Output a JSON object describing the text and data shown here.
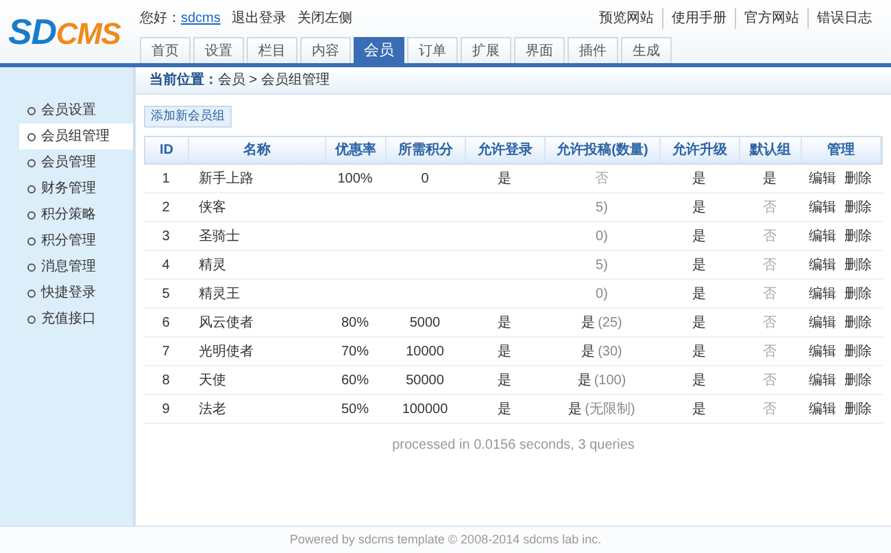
{
  "logo": {
    "left": "SD",
    "right": "CMS"
  },
  "user_bar": {
    "greeting": "您好：",
    "username": "sdcms",
    "links": [
      "退出登录",
      "关闭左侧"
    ]
  },
  "top_links": [
    "预览网站",
    "使用手册",
    "官方网站",
    "错误日志"
  ],
  "tabs": [
    {
      "label": "首页",
      "selected": false
    },
    {
      "label": "设置",
      "selected": false
    },
    {
      "label": "栏目",
      "selected": false
    },
    {
      "label": "内容",
      "selected": false
    },
    {
      "label": "会员",
      "selected": true
    },
    {
      "label": "订单",
      "selected": false
    },
    {
      "label": "扩展",
      "selected": false
    },
    {
      "label": "界面",
      "selected": false
    },
    {
      "label": "插件",
      "selected": false
    },
    {
      "label": "生成",
      "selected": false
    }
  ],
  "sidebar": {
    "items": [
      {
        "label": "会员设置",
        "selected": false
      },
      {
        "label": "会员组管理",
        "selected": true
      },
      {
        "label": "会员管理",
        "selected": false
      },
      {
        "label": "财务管理",
        "selected": false
      },
      {
        "label": "积分策略",
        "selected": false
      },
      {
        "label": "积分管理",
        "selected": false
      },
      {
        "label": "消息管理",
        "selected": false
      },
      {
        "label": "快捷登录",
        "selected": false
      },
      {
        "label": "充值接口",
        "selected": false
      }
    ]
  },
  "breadcrumb": {
    "label": "当前位置：",
    "path": "会员 > 会员组管理"
  },
  "add_button": "添加新会员组",
  "table": {
    "columns": [
      "ID",
      "名称",
      "优惠率",
      "所需积分",
      "允许登录",
      "允许投稿(数量)",
      "允许升级",
      "默认组",
      "管理"
    ],
    "rows": [
      {
        "id": "1",
        "name": "新手上路",
        "discount": "100%",
        "points": "0",
        "login": {
          "text": "是",
          "dim": false
        },
        "submit": {
          "text": "否",
          "dim": true
        },
        "upgrade": {
          "text": "是",
          "dim": false
        },
        "default": {
          "text": "是",
          "dim": false
        },
        "actions": [
          "编辑",
          "删除"
        ]
      },
      {
        "id": "2",
        "name": "侠客",
        "submit": {
          "count": "5)"
        },
        "upgrade": {
          "text": "是",
          "dim": false
        },
        "default": {
          "text": "否",
          "dim": true
        },
        "actions": [
          "编辑",
          "删除"
        ]
      },
      {
        "id": "3",
        "name": "圣骑士",
        "submit": {
          "count": "0)"
        },
        "upgrade": {
          "text": "是",
          "dim": false
        },
        "default": {
          "text": "否",
          "dim": true
        },
        "actions": [
          "编辑",
          "删除"
        ]
      },
      {
        "id": "4",
        "name": "精灵",
        "submit": {
          "count": "5)"
        },
        "upgrade": {
          "text": "是",
          "dim": false
        },
        "default": {
          "text": "否",
          "dim": true
        },
        "actions": [
          "编辑",
          "删除"
        ]
      },
      {
        "id": "5",
        "name": "精灵王",
        "submit": {
          "count": "0)"
        },
        "upgrade": {
          "text": "是",
          "dim": false
        },
        "default": {
          "text": "否",
          "dim": true
        },
        "actions": [
          "编辑",
          "删除"
        ]
      },
      {
        "id": "6",
        "name": "风云使者",
        "discount": "80%",
        "points": "5000",
        "login": {
          "text": "是",
          "dim": false
        },
        "submit": {
          "text": "是",
          "dim": false,
          "count": "(25)"
        },
        "upgrade": {
          "text": "是",
          "dim": false
        },
        "default": {
          "text": "否",
          "dim": true
        },
        "actions": [
          "编辑",
          "删除"
        ]
      },
      {
        "id": "7",
        "name": "光明使者",
        "discount": "70%",
        "points": "10000",
        "login": {
          "text": "是",
          "dim": false
        },
        "submit": {
          "text": "是",
          "dim": false,
          "count": "(30)"
        },
        "upgrade": {
          "text": "是",
          "dim": false
        },
        "default": {
          "text": "否",
          "dim": true
        },
        "actions": [
          "编辑",
          "删除"
        ]
      },
      {
        "id": "8",
        "name": "天使",
        "discount": "60%",
        "points": "50000",
        "login": {
          "text": "是",
          "dim": false
        },
        "submit": {
          "text": "是",
          "dim": false,
          "count": "(100)"
        },
        "upgrade": {
          "text": "是",
          "dim": false
        },
        "default": {
          "text": "否",
          "dim": true
        },
        "actions": [
          "编辑",
          "删除"
        ]
      },
      {
        "id": "9",
        "name": "法老",
        "discount": "50%",
        "points": "100000",
        "login": {
          "text": "是",
          "dim": false
        },
        "submit": {
          "text": "是",
          "dim": false,
          "count": "(无限制)"
        },
        "upgrade": {
          "text": "是",
          "dim": false
        },
        "default": {
          "text": "否",
          "dim": true
        },
        "actions": [
          "编辑",
          "删除"
        ]
      }
    ]
  },
  "processed": "processed in 0.0156 seconds, 3 queries",
  "footer": "Powered by sdcms template © 2008-2014 sdcms lab inc."
}
